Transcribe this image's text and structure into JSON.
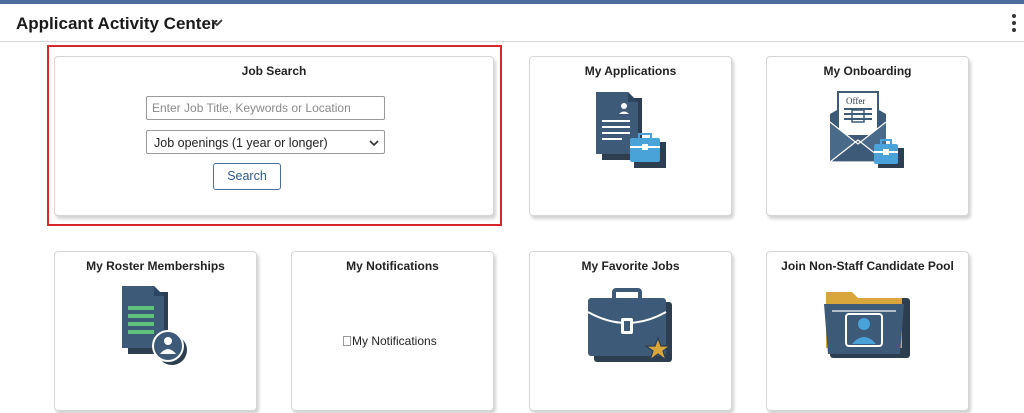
{
  "header": {
    "title": "Applicant Activity Center"
  },
  "job_search": {
    "title": "Job Search",
    "input_placeholder": "Enter Job Title, Keywords or Location",
    "input_value": "",
    "select_value": "Job openings (1 year or longer)",
    "button_label": "Search"
  },
  "tiles": {
    "my_applications": "My Applications",
    "my_onboarding": "My Onboarding",
    "offer_text": "Offer",
    "my_roster": "My Roster Memberships",
    "my_notifications": "My Notifications",
    "my_notifications_alt": "My Notifications",
    "my_favorite_jobs": "My Favorite Jobs",
    "join_pool": "Join Non-Staff Candidate Pool"
  },
  "colors": {
    "accent": "#4a6d99",
    "icon_navy": "#3d5a78",
    "icon_blue": "#4aa3d8",
    "highlight": "#d9262c",
    "star": "#d9a63c"
  }
}
